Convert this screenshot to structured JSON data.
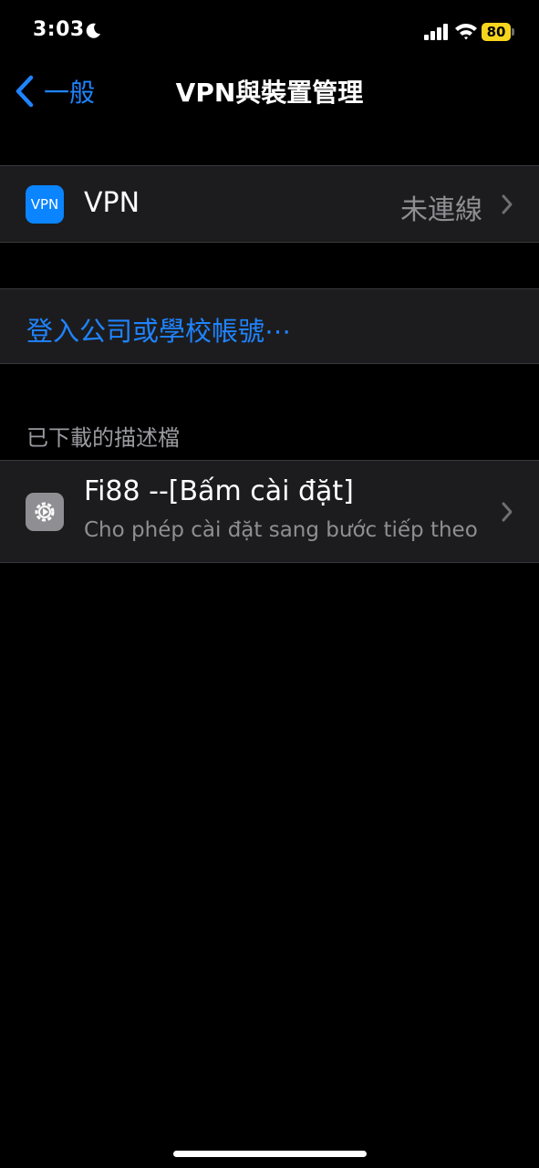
{
  "status_bar": {
    "time": "3:03",
    "battery_level": "80",
    "icons": [
      "moon-icon",
      "cellular-signal-icon",
      "wifi-icon",
      "battery-icon"
    ],
    "battery_color": "#f7d51e"
  },
  "nav": {
    "back_label": "一般",
    "title": "VPN與裝置管理"
  },
  "vpn_row": {
    "icon_text": "VPN",
    "label": "VPN",
    "status": "未連線"
  },
  "sign_in_row": {
    "label": "登入公司或學校帳號⋯"
  },
  "profiles_section": {
    "header": "已下載的描述檔",
    "items": [
      {
        "title": "Fi88 --[Bấm cài đặt]",
        "subtitle": "Cho phép cài đặt sang bước tiếp theo",
        "icon": "settings-gear-icon"
      }
    ]
  },
  "colors": {
    "accent": "#1f84ff",
    "background": "#000000",
    "cell": "#1c1c1e",
    "secondary_text": "#8e8e93"
  }
}
